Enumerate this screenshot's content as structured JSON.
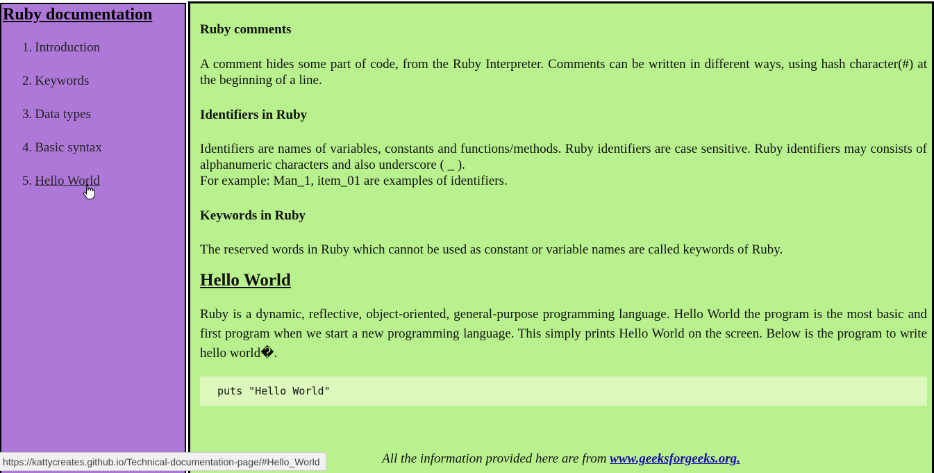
{
  "sidebar": {
    "title": "Ruby documentation",
    "items": [
      {
        "num": "1.",
        "label": "Introduction"
      },
      {
        "num": "2.",
        "label": "Keywords"
      },
      {
        "num": "3.",
        "label": "Data types"
      },
      {
        "num": "4.",
        "label": "Basic syntax"
      },
      {
        "num": "5.",
        "label": "Hello World"
      }
    ]
  },
  "main": {
    "comments_heading": "Ruby comments",
    "comments_text": "A comment hides some part of code, from the Ruby Interpreter. Comments can be written in different ways, using hash character(#) at the beginning of a line.",
    "identifiers_heading": "Identifiers in Ruby",
    "identifiers_text": "Identifiers are names of variables, constants and functions/methods. Ruby identifiers are case sensitive. Ruby identifiers may consists of alphanumeric characters and also underscore ( _ ).",
    "identifiers_example": "For example: Man_1, item_01 are examples of identifiers.",
    "keywords_heading": "Keywords in Ruby",
    "keywords_text": "The reserved words in Ruby which cannot be used as constant or variable names are called keywords of Ruby.",
    "hello_heading": "Hello World",
    "hello_text": "Ruby is a dynamic, reflective, object-oriented, general-purpose programming language. Hello World the program is the most basic and first program when we start a new programming language. This simply prints Hello World on the screen. Below is the program to write hello world�.",
    "code": "puts \"Hello World\"",
    "footer_text": "All the information provided here are from ",
    "footer_link": "www.geeksforgeeks.org."
  },
  "status_bar": {
    "url": "https://kattycreates.github.io/Technical-documentation-page/#Hello_World"
  },
  "colors": {
    "sidebar_bg": "#ae78d9",
    "main_bg": "#b8f18d",
    "code_bg": "#dcf8bc",
    "link": "#1a0dab"
  },
  "icons": {
    "cursor": "hand-pointer-icon"
  }
}
